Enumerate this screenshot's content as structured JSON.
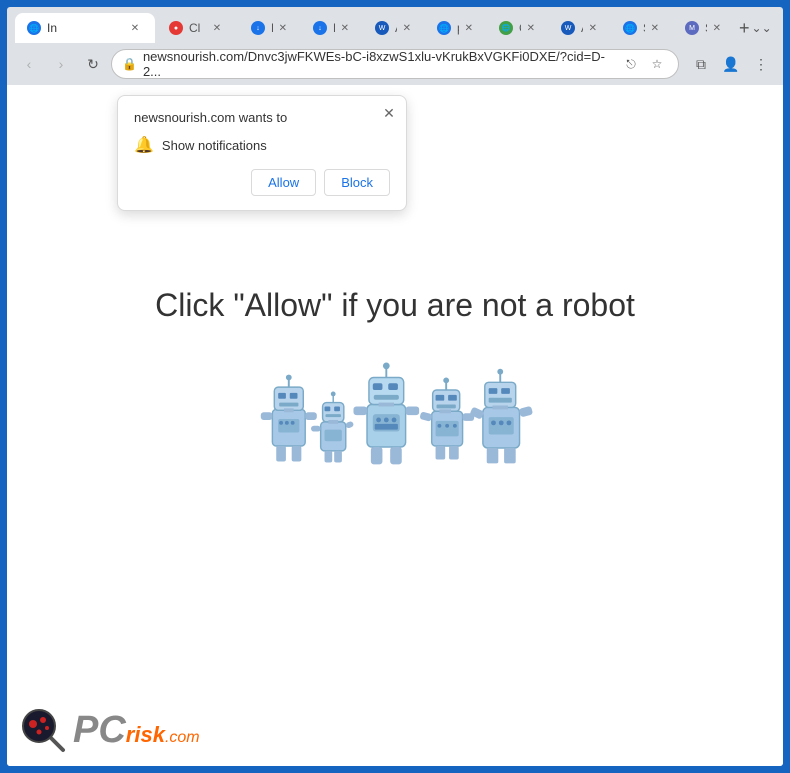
{
  "browser": {
    "tabs": [
      {
        "id": "tab1",
        "label": "In",
        "icon": "globe",
        "active": true
      },
      {
        "id": "tab2",
        "label": "Cl",
        "icon": "red",
        "active": false
      },
      {
        "id": "tab3",
        "label": "D",
        "icon": "download",
        "active": false
      },
      {
        "id": "tab4",
        "label": "D",
        "icon": "download2",
        "active": false
      },
      {
        "id": "tab5",
        "label": "A",
        "icon": "word",
        "active": false
      },
      {
        "id": "tab6",
        "label": "p",
        "icon": "globe2",
        "active": false
      },
      {
        "id": "tab7",
        "label": "C",
        "icon": "globe3",
        "active": false
      },
      {
        "id": "tab8",
        "label": "A",
        "icon": "word2",
        "active": false
      },
      {
        "id": "tab9",
        "label": "Si",
        "icon": "globe4",
        "active": false
      },
      {
        "id": "tab10",
        "label": "Si",
        "icon": "M",
        "active": false
      }
    ],
    "address": "newsnourish.com/Dnvc3jwFKWEs-bC-i8xzwS1xlu-vKrukBxVGKFi0DXE/?cid=D-2...",
    "new_tab_label": "+",
    "window_controls": {
      "minimize": "—",
      "maximize": "□",
      "close": "✕"
    }
  },
  "notification_popup": {
    "title": "newsnourish.com wants to",
    "permission": "Show notifications",
    "allow_label": "Allow",
    "block_label": "Block",
    "close_icon": "✕"
  },
  "page": {
    "main_text": "Click \"Allow\"   if you are not   a robot"
  },
  "watermark": {
    "pc_text": "PC",
    "risk_text": "risk",
    "com_text": ".com"
  },
  "colors": {
    "allow_blue": "#1a73e8",
    "block_blue": "#1a73e8",
    "browser_border": "#1565c0",
    "tab_active_bg": "#ffffff",
    "tab_inactive_bg": "transparent"
  }
}
